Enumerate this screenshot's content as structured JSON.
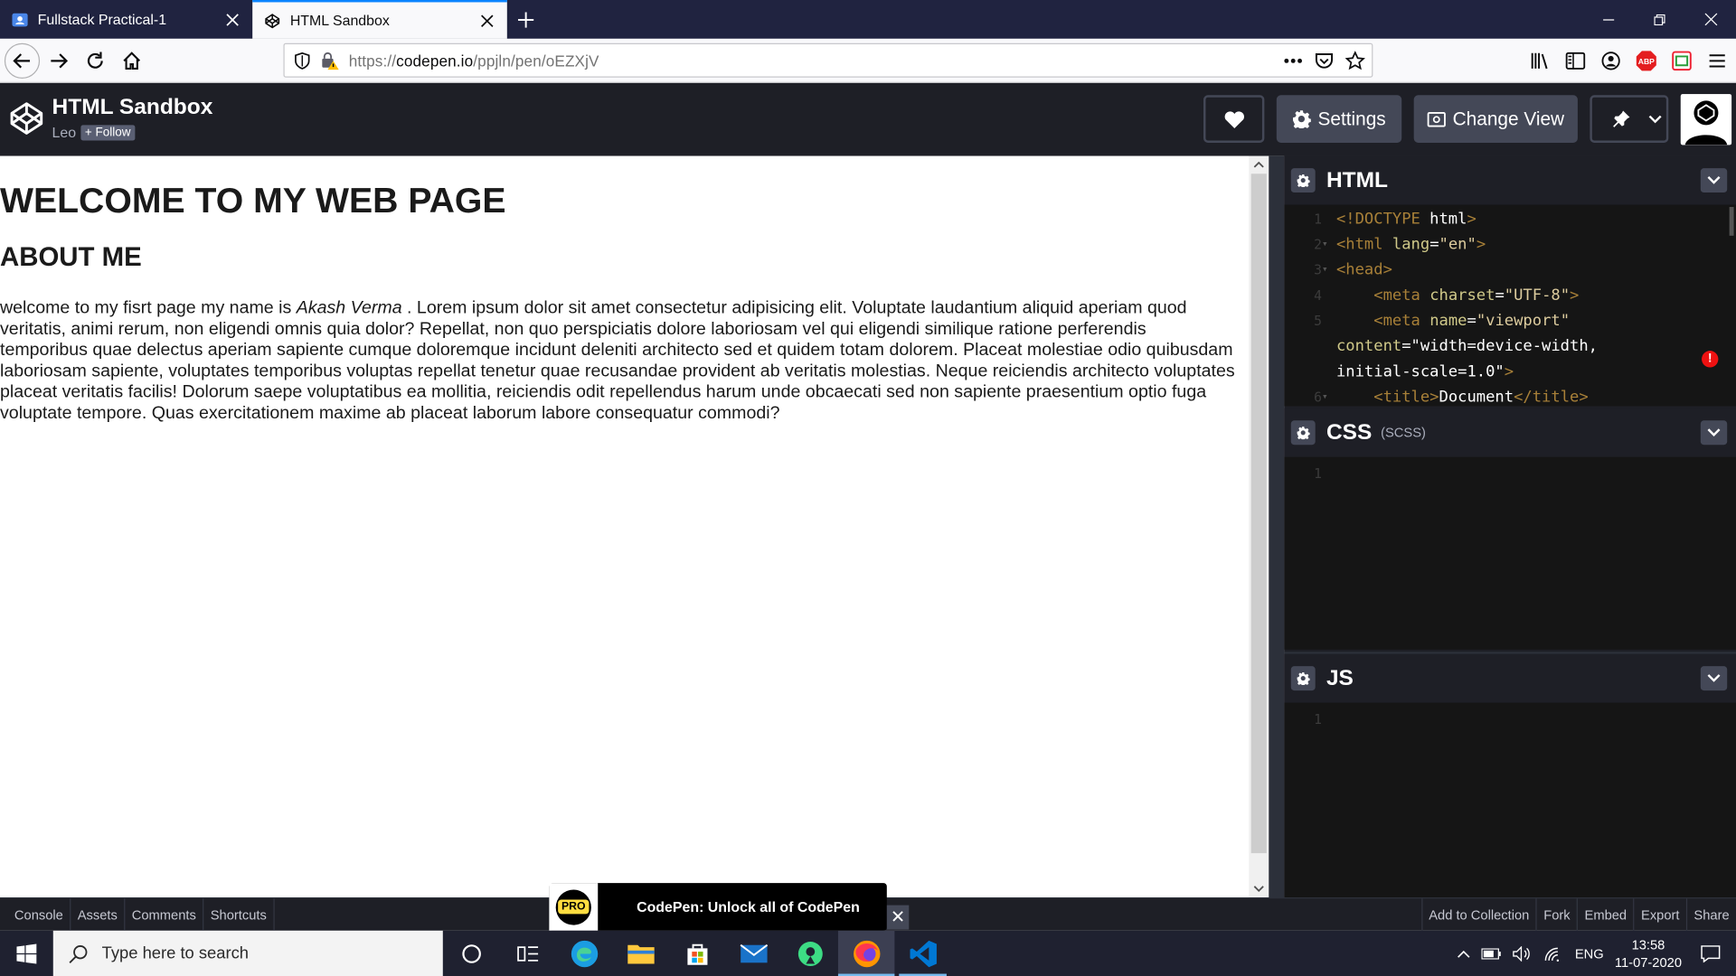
{
  "browser": {
    "tabs": [
      {
        "title": "Fullstack Practical-1",
        "icon": "user-board-icon",
        "active": false
      },
      {
        "title": "HTML Sandbox",
        "icon": "codepen-icon",
        "active": true
      }
    ],
    "url_prefix": "https://",
    "url_domain": "codepen.io",
    "url_path": "/ppjln/pen/oEZXjV"
  },
  "codepen": {
    "title": "HTML Sandbox",
    "user": "Leo",
    "follow_label": "+ Follow",
    "settings_label": "Settings",
    "change_view_label": "Change View"
  },
  "preview": {
    "h1": "WELCOME TO MY WEB PAGE",
    "h2": "ABOUT ME",
    "para_start": "welcome to my fisrt page my name is ",
    "para_name": "Akash Verma",
    "para_rest": " . Lorem ipsum dolor sit amet consectetur adipisicing elit. Voluptate laudantium aliquid aperiam quod veritatis, animi rerum, non eligendi omnis quia dolor? Repellat, non quo perspiciatis dolore laboriosam vel qui eligendi similique ratione perferendis temporibus quae delectus aperiam sapiente cumque doloremque incidunt deleniti architecto sed et quidem totam dolorem. Placeat molestiae odio quibusdam laboriosam sapiente, voluptates temporibus voluptas repellat tenetur quae recusandae provident ab veritatis molestias. Neque reiciendis architecto voluptates placeat veritatis facilis! Dolorum saepe voluptatibus ea mollitia, reiciendis odit repellendus harum unde obcaecati sed non sapiente praesentium optio fuga voluptate tempore. Quas exercitationem maxime ab placeat laborum labore consequatur commodi?"
  },
  "editors": {
    "html": {
      "name": "HTML",
      "lines": [
        {
          "n": "1",
          "fold": "",
          "t": "<!DOCTYPE html>"
        },
        {
          "n": "2",
          "fold": "▾",
          "t": "<html lang=\"en\">"
        },
        {
          "n": "3",
          "fold": "▾",
          "t": "<head>"
        },
        {
          "n": "4",
          "fold": "",
          "t": "    <meta charset=\"UTF-8\">"
        },
        {
          "n": "5",
          "fold": "",
          "t": "    <meta name=\"viewport\""
        },
        {
          "n": "",
          "fold": "",
          "t": "content=\"width=device-width,"
        },
        {
          "n": "",
          "fold": "",
          "t": "initial-scale=1.0\">"
        },
        {
          "n": "6",
          "fold": "▾",
          "t": "    <title>Document</title>"
        }
      ]
    },
    "css": {
      "name": "CSS",
      "sub": "(SCSS)",
      "line": "1"
    },
    "js": {
      "name": "JS",
      "line": "1"
    }
  },
  "footer": {
    "left": [
      "Console",
      "Assets",
      "Comments",
      "Shortcuts"
    ],
    "right": [
      "Add to Collection",
      "Fork",
      "Embed",
      "Export",
      "Share"
    ],
    "promo_badge": "PRO",
    "promo_text": "CodePen: Unlock all of CodePen",
    "promo_close": "✕"
  },
  "taskbar": {
    "search_placeholder": "Type here to search",
    "lang": "ENG",
    "time": "13:58",
    "date": "11-07-2020"
  },
  "colors": {
    "codepen_dark": "#1e1f26",
    "button_gray": "#444857",
    "firefox_tab_accent": "#0a84ff"
  }
}
